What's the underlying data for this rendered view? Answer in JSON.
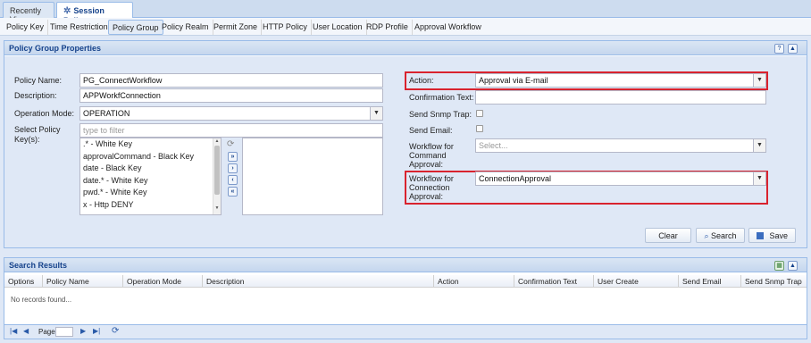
{
  "top_tabs": [
    {
      "label": "Recently View"
    },
    {
      "label": "Session Policy"
    }
  ],
  "sub_tabs": [
    "Policy Key",
    "Time Restriction",
    "Policy Group",
    "Policy Realm",
    "Permit Zone",
    "HTTP Policy",
    "User Location",
    "RDP Profile",
    "Approval Workflow"
  ],
  "properties": {
    "title": "Policy Group Properties",
    "policy_name_label": "Policy Name:",
    "policy_name_value": "PG_ConnectWorkflow",
    "description_label": "Description:",
    "description_value": "APPWorkfConnection",
    "operation_mode_label": "Operation Mode:",
    "operation_mode_value": "OPERATION",
    "select_keys_label_1": "Select Policy",
    "select_keys_label_2": "Key(s):",
    "filter_placeholder": "type to filter",
    "keys": [
      ".* - White Key",
      "approvalCommand - Black Key",
      "date - Black Key",
      "date.* - White Key",
      "pwd.* - White Key",
      "x - Http DENY"
    ],
    "action_label": "Action:",
    "action_value": "Approval via E-mail",
    "confirmation_label": "Confirmation Text:",
    "confirmation_value": "",
    "snmp_label": "Send Snmp Trap:",
    "email_label": "Send Email:",
    "wf_command_label_1": "Workflow for",
    "wf_command_label_2": "Command",
    "wf_command_label_3": "Approval:",
    "wf_command_placeholder": "Select...",
    "wf_conn_label_1": "Workflow for",
    "wf_conn_label_2": "Connection",
    "wf_conn_label_3": "Approval:",
    "wf_conn_value": "ConnectionApproval",
    "clear_label": "Clear",
    "search_label": "Search",
    "save_label": "Save"
  },
  "results": {
    "title": "Search Results",
    "columns": [
      "Options",
      "Policy Name",
      "Operation Mode",
      "Description",
      "Action",
      "Confirmation Text",
      "User Create",
      "Send Email",
      "Send Snmp Trap"
    ],
    "empty_text": "No records found...",
    "page_label": "Page"
  },
  "colors": {
    "accent": "#15428b",
    "highlight": "#d9232e"
  }
}
